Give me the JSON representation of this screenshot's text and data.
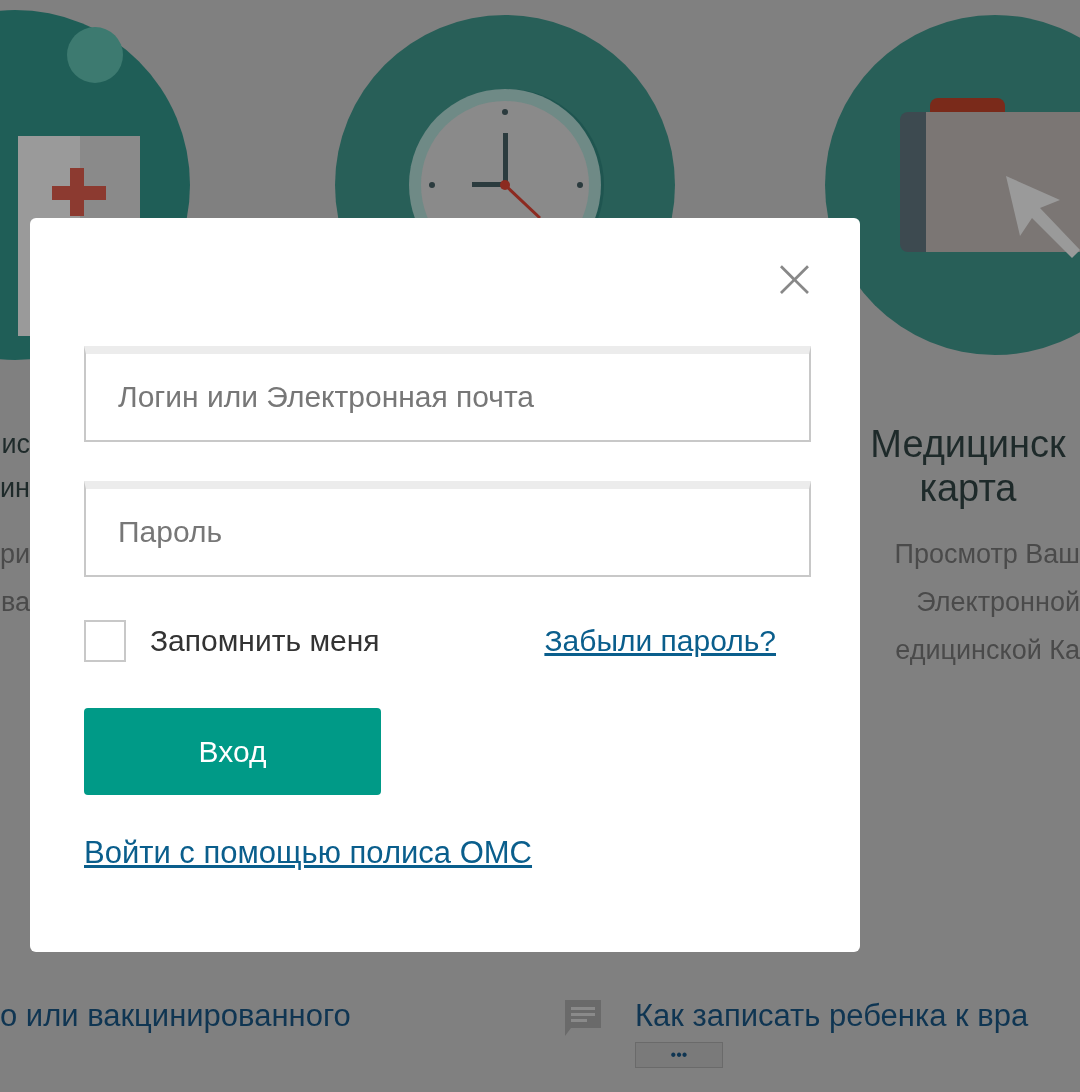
{
  "background": {
    "cards": [
      {
        "title_lines": [
          "ис",
          "ин"
        ],
        "description_lines": [
          "ри",
          "ва"
        ]
      },
      {
        "title_lines": [
          "Медицинск",
          "карта"
        ],
        "description_lines": [
          "Просмотр Ваш",
          "Электронной",
          "едицинской Ка"
        ]
      }
    ],
    "links": [
      {
        "kind": "plain",
        "text": "о или вакцинированного"
      },
      {
        "kind": "comment",
        "text": "Как записать ребенка к вра",
        "more": "•••"
      }
    ]
  },
  "dialog": {
    "close": "×",
    "login_field": {
      "placeholder": "Логин или Электронная почта"
    },
    "password_field": {
      "placeholder": "Пароль"
    },
    "remember": {
      "label": "Запомнить меня",
      "checked": false
    },
    "forgot_link": "Забыли пароль?",
    "submit_button": "Вход",
    "oms_link": "Войти с помощью полиса ОМС"
  }
}
